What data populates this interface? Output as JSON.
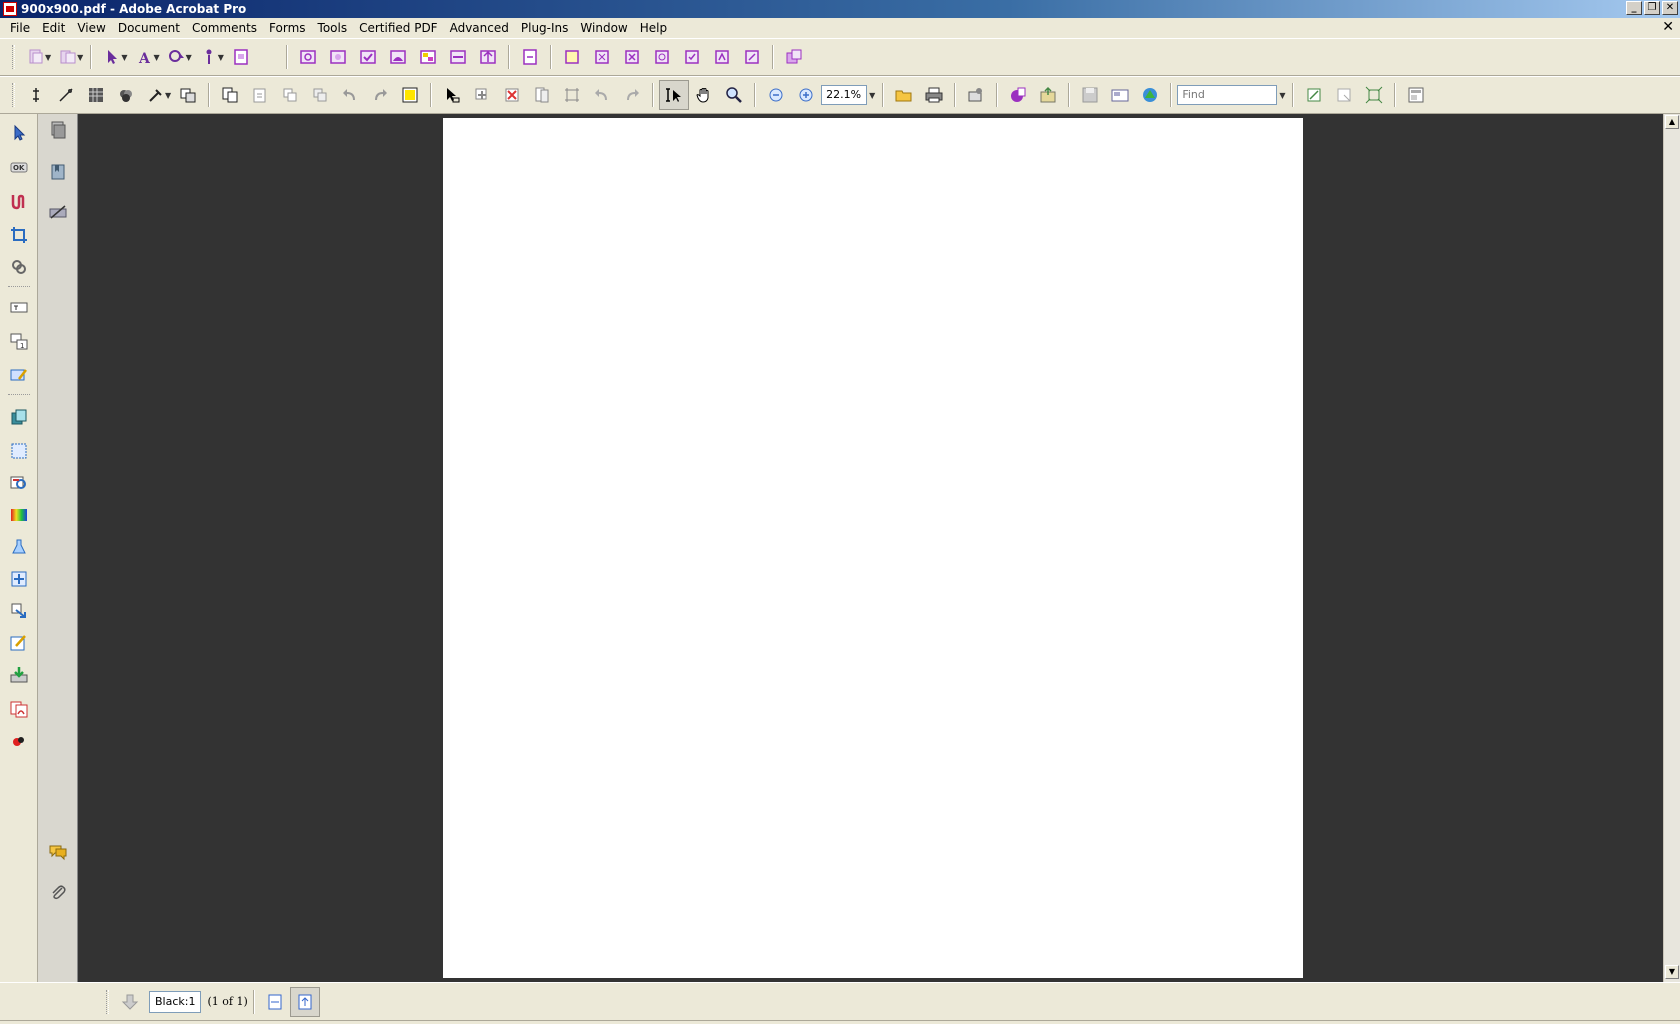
{
  "window": {
    "title": "900x900.pdf - Adobe Acrobat Pro",
    "minimize_glyph": "_",
    "restore_glyph": "❐",
    "close_glyph": "✕"
  },
  "menu": {
    "items": [
      "File",
      "Edit",
      "View",
      "Document",
      "Comments",
      "Forms",
      "Tools",
      "Certified PDF",
      "Advanced",
      "Plug-Ins",
      "Window",
      "Help"
    ],
    "doc_close_glyph": "✕"
  },
  "toolbar2": {
    "zoom_value": "22.1%",
    "find_placeholder": "Find"
  },
  "statusbar": {
    "page_field": "Black:1",
    "page_count": "(1 of 1)"
  },
  "colors": {
    "document_background": "#333333",
    "page": "#ffffff",
    "chrome": "#ece9d8",
    "accent_purple": "#9b30c0"
  },
  "icons": {
    "toolbar1": [
      "create-pdf-icon",
      "combine-icon",
      "select-icon",
      "text-touchup-icon",
      "object-touchup-icon",
      "reading-order-icon",
      "preflight-icon",
      "output-preview-icon",
      "convert-colors-icon",
      "ink-manager-icon",
      "trap-presets-icon",
      "transparency-flattening-icon",
      "pdf-optimizer-icon",
      "fix-hairlines-icon",
      "add-printer-marks-icon",
      "crop-pages-icon",
      "javascript-icon",
      "edit-pages-icon",
      "links-icon",
      "bookmarks-icon",
      "layers-icon"
    ],
    "toolbar2": [
      "split-icon",
      "measure-icon",
      "dither-icon",
      "separation-icon",
      "color-pick-icon",
      "replace-icon",
      "copy-icon",
      "paste-icon",
      "duplicate-icon",
      "group-icon",
      "undo-icon",
      "redo-icon",
      "fill-color-icon",
      "select-object-icon",
      "move-icon",
      "delete-icon",
      "page-icon",
      "frame-icon",
      "rotate-left-icon",
      "rotate-right-icon",
      "text-select-icon",
      "hand-icon",
      "zoom-icon",
      "zoom-out-icon",
      "zoom-in-icon",
      "open-icon",
      "print-icon",
      "email-icon",
      "review-icon",
      "export-icon",
      "save-icon",
      "attach-icon",
      "web-icon",
      "fit-width-icon",
      "marquee-icon",
      "full-screen-icon",
      "settings-icon"
    ],
    "lefttools": [
      "arrow-icon",
      "ok-button-icon",
      "u-shape-icon",
      "crop-icon",
      "link-icon",
      "text-field-icon",
      "numbering-icon",
      "edit-form-icon",
      "copy-page-icon",
      "page-frame-icon",
      "image-edit-icon",
      "gradient-icon",
      "flask-icon",
      "mark-icon",
      "transform-icon",
      "edit-text-icon",
      "import-icon",
      "pdf-icon",
      "color-icon"
    ],
    "navpane": [
      "pages-icon",
      "bookmarks-panel-icon",
      "signatures-icon",
      "comments-icon",
      "attachments-icon"
    ]
  }
}
